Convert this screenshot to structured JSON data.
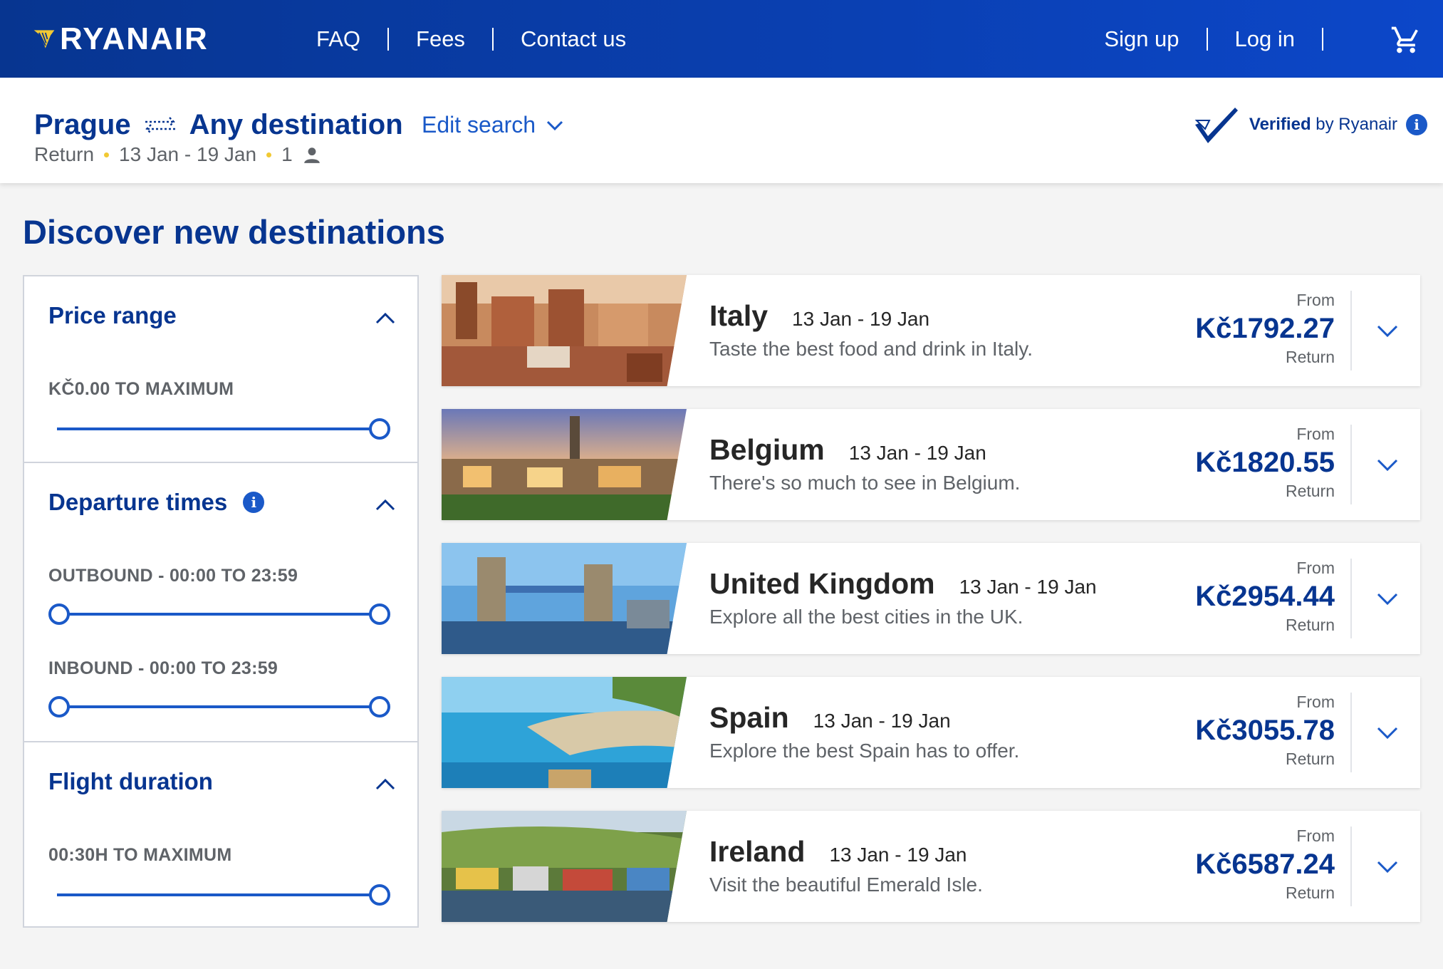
{
  "brand": {
    "name": "RYANAIR"
  },
  "nav": {
    "left": [
      "FAQ",
      "Fees",
      "Contact us"
    ],
    "right": [
      "Sign up",
      "Log in"
    ],
    "cart_icon": "cart-icon"
  },
  "search": {
    "origin": "Prague",
    "destination": "Any destination",
    "edit_label": "Edit search",
    "trip_type": "Return",
    "dates": "13 Jan - 19 Jan",
    "passengers": "1",
    "verified_bold": "Verified",
    "verified_rest": " by Ryanair"
  },
  "page_title": "Discover new destinations",
  "filters": {
    "price": {
      "title": "Price range",
      "label": "KČ0.00 TO MAXIMUM",
      "slider_max_fraction": 1.0
    },
    "departure": {
      "title": "Departure times",
      "outbound_label": "OUTBOUND - 00:00 TO 23:59",
      "inbound_label": "INBOUND - 00:00 TO 23:59"
    },
    "duration": {
      "title": "Flight duration",
      "label": "00:30H TO MAXIMUM",
      "slider_max_fraction": 1.0
    }
  },
  "destinations": [
    {
      "country": "Italy",
      "dates": "13 Jan - 19 Jan",
      "desc": "Taste the best food and drink in Italy.",
      "from": "From",
      "price": "Kč1792.27",
      "ret": "Return"
    },
    {
      "country": "Belgium",
      "dates": "13 Jan - 19 Jan",
      "desc": "There's so much to see in Belgium.",
      "from": "From",
      "price": "Kč1820.55",
      "ret": "Return"
    },
    {
      "country": "United Kingdom",
      "dates": "13 Jan - 19 Jan",
      "desc": "Explore all the best cities in the UK.",
      "from": "From",
      "price": "Kč2954.44",
      "ret": "Return"
    },
    {
      "country": "Spain",
      "dates": "13 Jan - 19 Jan",
      "desc": "Explore the best Spain has to offer.",
      "from": "From",
      "price": "Kč3055.78",
      "ret": "Return"
    },
    {
      "country": "Ireland",
      "dates": "13 Jan - 19 Jan",
      "desc": "Visit the beautiful Emerald Isle.",
      "from": "From",
      "price": "Kč6587.24",
      "ret": "Return"
    }
  ],
  "colors": {
    "brand_blue": "#073590",
    "accent_blue": "#1a59c8",
    "yellow": "#f1c933"
  }
}
